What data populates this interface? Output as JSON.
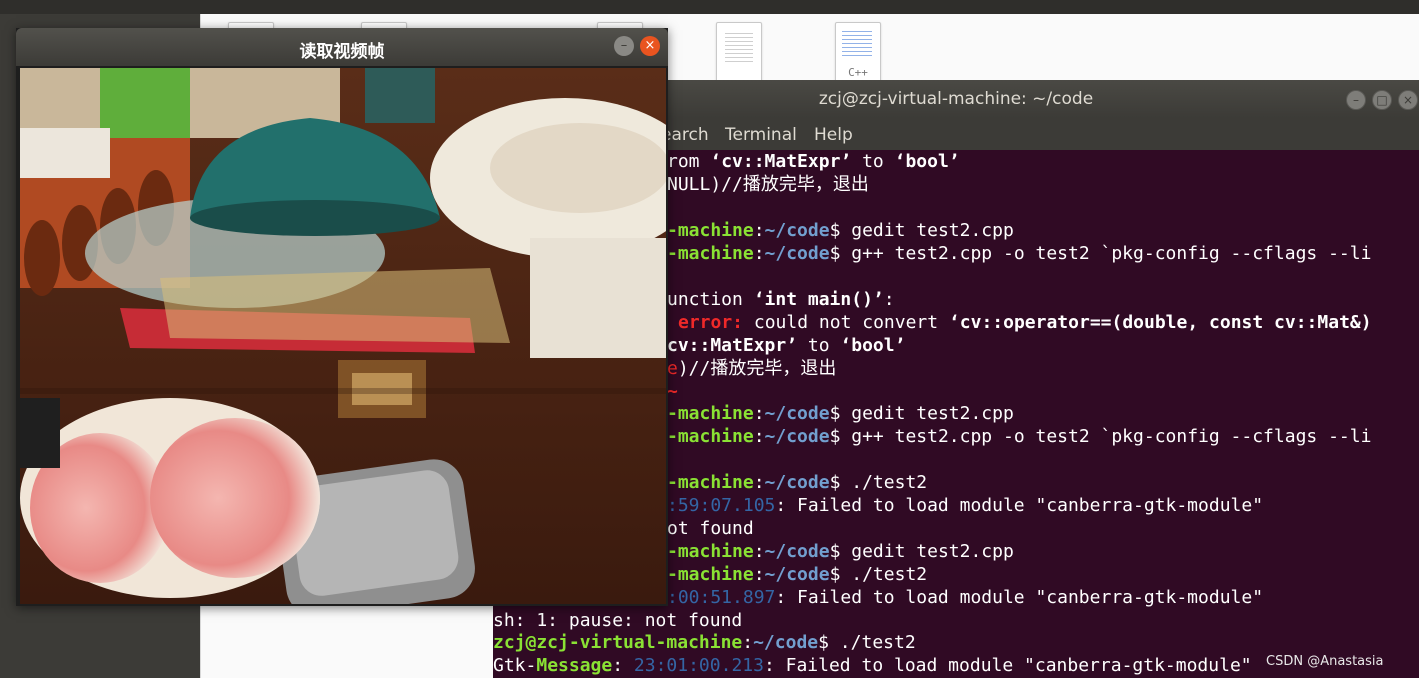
{
  "file_manager": {
    "file_label_cpp": "C++"
  },
  "terminal": {
    "title": "zcj@zcj-virtual-machine: ~/code",
    "menu": [
      "earch",
      "Terminal",
      "Help"
    ],
    "lines": [
      {
        "type": "a",
        "t1": "rom ",
        "t2": "‘cv::MatExpr’",
        "t3": " to ",
        "t4": "‘bool’"
      },
      {
        "type": "plain",
        "text": "NULL)//播放完毕，退出"
      },
      {
        "type": "prompt",
        "host": "-machine",
        "path": "~/code",
        "cmd": " gedit test2.cpp"
      },
      {
        "type": "prompt",
        "host": "-machine",
        "path": "~/code",
        "cmd": " g++ test2.cpp -o test2 `pkg-config --cflags --li"
      },
      {
        "type": "fn",
        "t1": "unction ",
        "t2": "‘int main()’",
        "t3": ":"
      },
      {
        "type": "err",
        "label": "error:",
        "t1": " could not convert ",
        "t2": "‘cv::operator==(double, const cv::Mat&)"
      },
      {
        "type": "a",
        "t1": "",
        "t2": "cv::MatExpr’",
        "t3": " to ",
        "t4": "‘bool’"
      },
      {
        "type": "redpart",
        "red": "e",
        "rest": ")//播放完毕，退出"
      },
      {
        "type": "tilde",
        "text": "~"
      },
      {
        "type": "prompt",
        "host": "-machine",
        "path": "~/code",
        "cmd": " gedit test2.cpp"
      },
      {
        "type": "prompt",
        "host": "-machine",
        "path": "~/code",
        "cmd": " g++ test2.cpp -o test2 `pkg-config --cflags --li"
      },
      {
        "type": "prompt",
        "host": "-machine",
        "path": "~/code",
        "cmd": " ./test2"
      },
      {
        "type": "ts",
        "ts": ":59:07.105",
        "rest": ": Failed to load module \"canberra-gtk-module\""
      },
      {
        "type": "plain",
        "text": "ot found"
      },
      {
        "type": "prompt",
        "host": "-machine",
        "path": "~/code",
        "cmd": " gedit test2.cpp"
      },
      {
        "type": "prompt",
        "host": "-machine",
        "path": "~/code",
        "cmd": " ./test2"
      },
      {
        "type": "ts",
        "ts": ":00:51.897",
        "rest": ": Failed to load module \"canberra-gtk-module\""
      },
      {
        "type": "plain",
        "text": "sh: 1: pause: not found"
      },
      {
        "type": "fullprompt",
        "user": "zcj@zcj-virtual-machine",
        "path": "~/code",
        "cmd": " ./test2"
      },
      {
        "type": "gtk",
        "label": "Gtk-Message",
        "ts": "23:01:00.213",
        "rest": ": Failed to load module \"canberra-gtk-module\""
      }
    ],
    "prompt_sep": ":",
    "prompt_dollar": "$",
    "gtk_colon": ": "
  },
  "video_window": {
    "title": "读取视频帧",
    "minimize_glyph": "–",
    "close_glyph": "×"
  },
  "watermark": "CSDN @Anastasia͏"
}
